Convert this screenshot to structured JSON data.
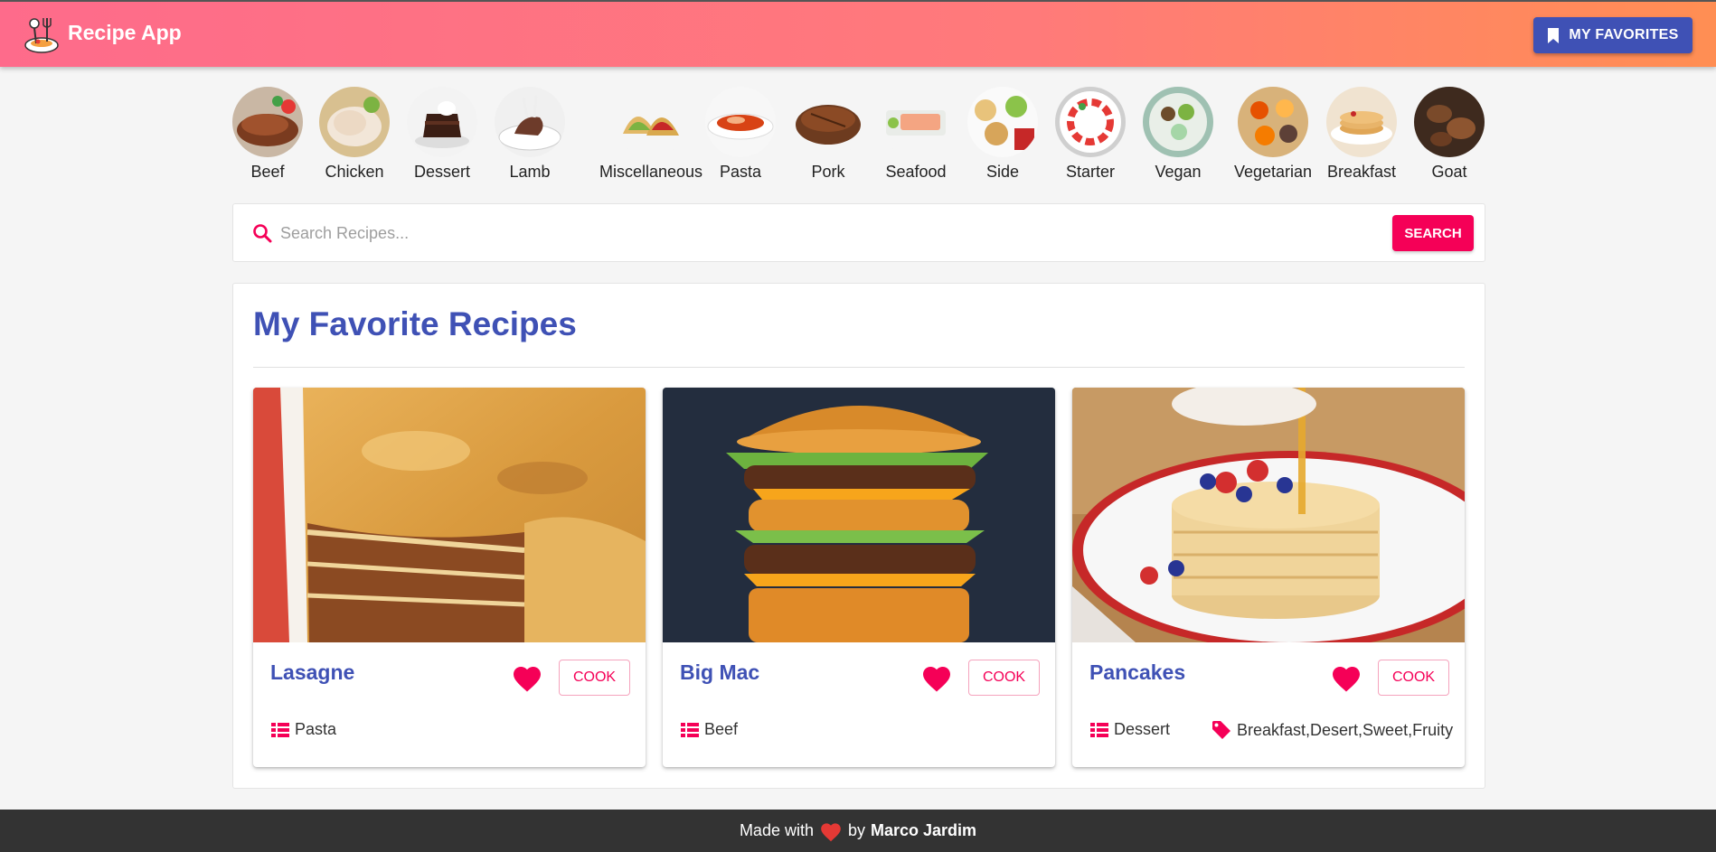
{
  "header": {
    "app_title": "Recipe App",
    "favorites_button": "MY FAVORITES",
    "background_gradient": [
      "#fe6b8b",
      "#ff8e53"
    ],
    "button_color": "#3f51b5"
  },
  "categories": [
    {
      "label": "Beef",
      "icon": "beef-thumbnail"
    },
    {
      "label": "Chicken",
      "icon": "chicken-thumbnail"
    },
    {
      "label": "Dessert",
      "icon": "dessert-thumbnail"
    },
    {
      "label": "Lamb",
      "icon": "lamb-thumbnail"
    },
    {
      "label": "Miscellaneous",
      "icon": "miscellaneous-thumbnail"
    },
    {
      "label": "Pasta",
      "icon": "pasta-thumbnail"
    },
    {
      "label": "Pork",
      "icon": "pork-thumbnail"
    },
    {
      "label": "Seafood",
      "icon": "seafood-thumbnail"
    },
    {
      "label": "Side",
      "icon": "side-thumbnail"
    },
    {
      "label": "Starter",
      "icon": "starter-thumbnail"
    },
    {
      "label": "Vegan",
      "icon": "vegan-thumbnail"
    },
    {
      "label": "Vegetarian",
      "icon": "vegetarian-thumbnail"
    },
    {
      "label": "Breakfast",
      "icon": "breakfast-thumbnail"
    },
    {
      "label": "Goat",
      "icon": "goat-thumbnail"
    }
  ],
  "search": {
    "placeholder": "Search Recipes...",
    "value": "",
    "button_label": "SEARCH",
    "accent_color": "#f50057"
  },
  "favorites": {
    "title": "My Favorite Recipes",
    "cards": [
      {
        "name": "Lasagne",
        "category": "Pasta",
        "tags": "",
        "cook_label": "COOK"
      },
      {
        "name": "Big Mac",
        "category": "Beef",
        "tags": "",
        "cook_label": "COOK"
      },
      {
        "name": "Pancakes",
        "category": "Dessert",
        "tags": "Breakfast,Desert,Sweet,Fruity",
        "cook_label": "COOK"
      }
    ]
  },
  "footer": {
    "made_with": "Made with",
    "by": "by",
    "author": "Marco Jardim"
  }
}
